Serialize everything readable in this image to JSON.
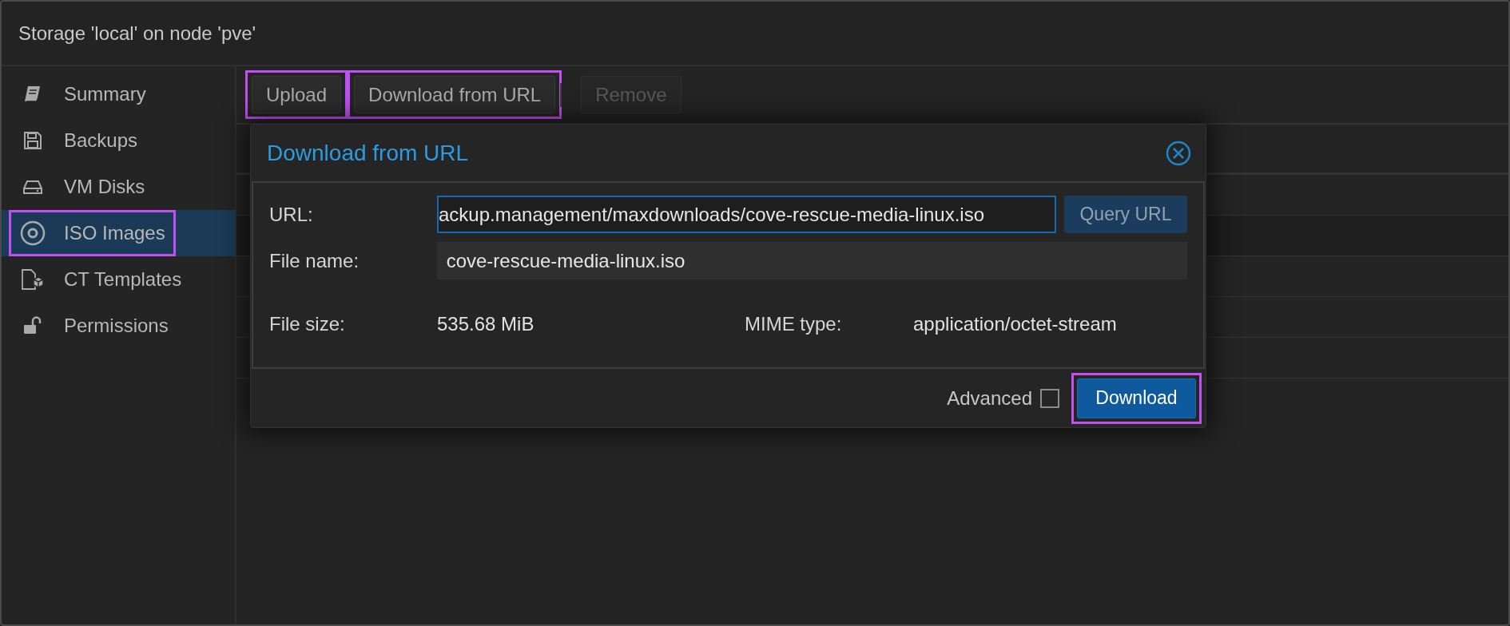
{
  "window": {
    "title": "Storage 'local' on node 'pve'"
  },
  "sidebar": {
    "items": [
      {
        "label": "Summary",
        "selected": false,
        "highlighted": false
      },
      {
        "label": "Backups",
        "selected": false,
        "highlighted": false
      },
      {
        "label": "VM Disks",
        "selected": false,
        "highlighted": false
      },
      {
        "label": "ISO Images",
        "selected": true,
        "highlighted": true
      },
      {
        "label": "CT Templates",
        "selected": false,
        "highlighted": false
      },
      {
        "label": "Permissions",
        "selected": false,
        "highlighted": false
      }
    ]
  },
  "toolbar": {
    "buttons": [
      {
        "label": "Upload",
        "disabled": false,
        "highlighted": true
      },
      {
        "label": "Download from URL",
        "disabled": false,
        "highlighted": true
      },
      {
        "label": "Remove",
        "disabled": true,
        "highlighted": false
      }
    ]
  },
  "dialog": {
    "title": "Download from URL",
    "url": {
      "label": "URL:",
      "value": "ackup.management/maxdownloads/cove-rescue-media-linux.iso",
      "button": "Query URL"
    },
    "file_name": {
      "label": "File name:",
      "value": "cove-rescue-media-linux.iso"
    },
    "file_size": {
      "label": "File size:",
      "value": "535.68 MiB"
    },
    "mime_type": {
      "label": "MIME type:",
      "value": "application/octet-stream"
    },
    "advanced": {
      "label": "Advanced",
      "checked": false
    },
    "download_button": {
      "label": "Download",
      "highlighted": true
    }
  }
}
